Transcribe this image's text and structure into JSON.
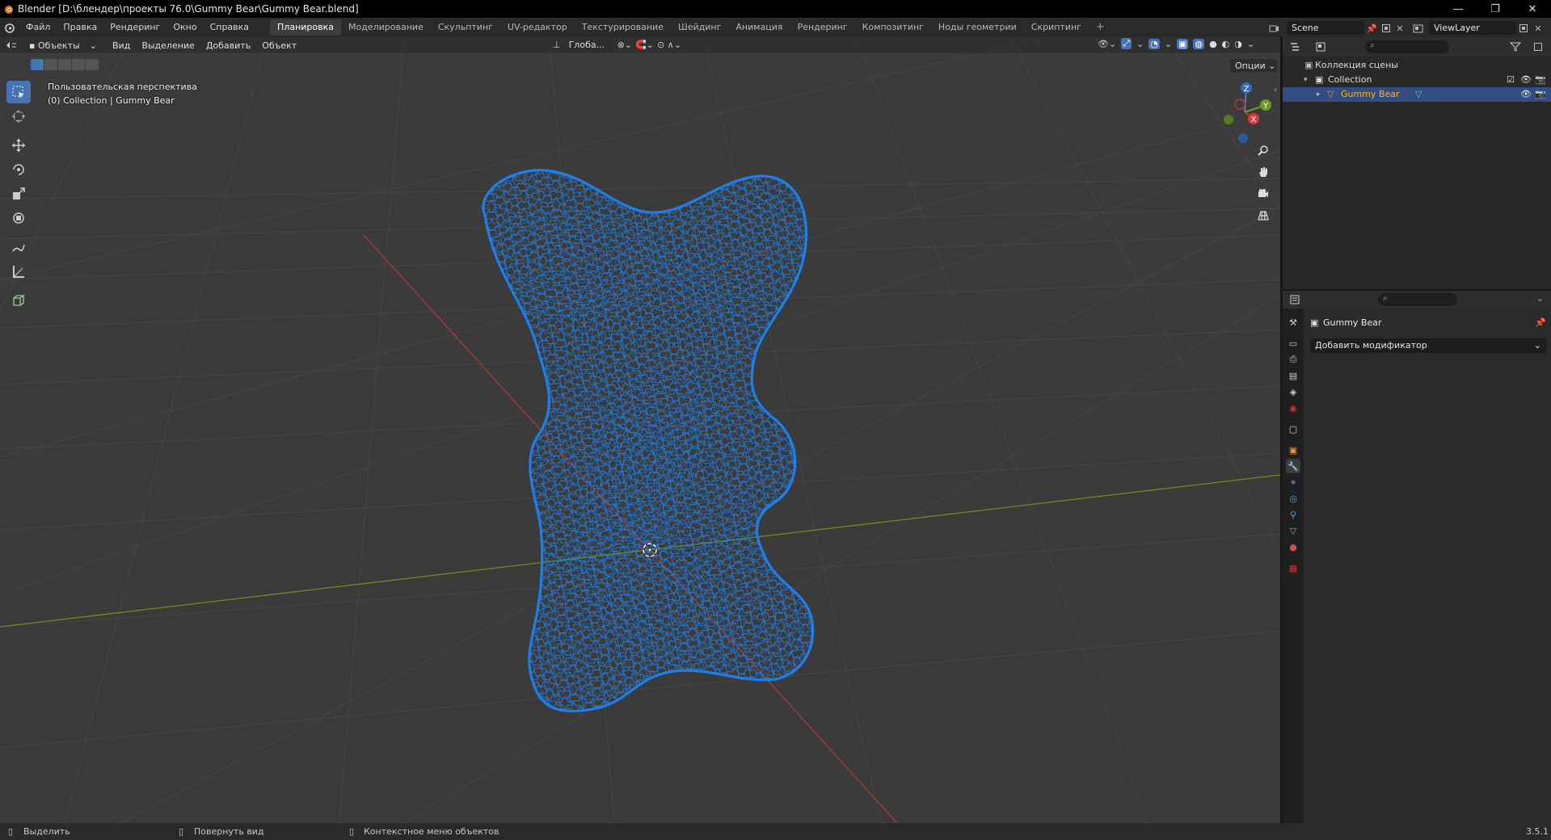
{
  "window": {
    "title": "Blender [D:\\блендер\\проекты 76.0\\Gummy Bear\\Gummy Bear.blend]",
    "controls": [
      "—",
      "❐",
      "✕"
    ]
  },
  "menu": {
    "items": [
      "Файл",
      "Правка",
      "Рендеринг",
      "Окно",
      "Справка"
    ]
  },
  "workspaces": {
    "tabs": [
      "Планировка",
      "Моделирование",
      "Скульптинг",
      "UV-редактор",
      "Текстурирование",
      "Шейдинг",
      "Анимация",
      "Рендеринг",
      "Композитинг",
      "Ноды геометрии",
      "Скриптинг"
    ],
    "active_index": 0,
    "add_label": "+"
  },
  "scene": {
    "name": "Scene",
    "view_layer": "ViewLayer"
  },
  "viewport": {
    "mode": "Объекты",
    "menus": [
      "Вид",
      "Выделение",
      "Добавить",
      "Объект"
    ],
    "transform_orientation": "Глоба...",
    "options_label": "Опции",
    "perspective_label": "Пользовательская перспектива",
    "collection_label": "(0) Collection | Gummy Bear",
    "gizmo_axes": {
      "z": "Z",
      "y": "Y",
      "x": "X"
    },
    "wire_color": "#1f7fe8",
    "x_axis_color": "#a83a3a",
    "y_axis_color": "#6b8e23",
    "background_color": "#3b3b3b"
  },
  "outliner": {
    "scene_collection": "Коллекция сцены",
    "collection": "Collection",
    "object": "Gummy Bear"
  },
  "properties": {
    "object_name": "Gummy Bear",
    "add_modifier": "Добавить модификатор"
  },
  "statusbar": {
    "select": "Выделить",
    "rotate": "Повернуть вид",
    "context": "Контекстное меню объектов",
    "version": "3.5.1"
  }
}
